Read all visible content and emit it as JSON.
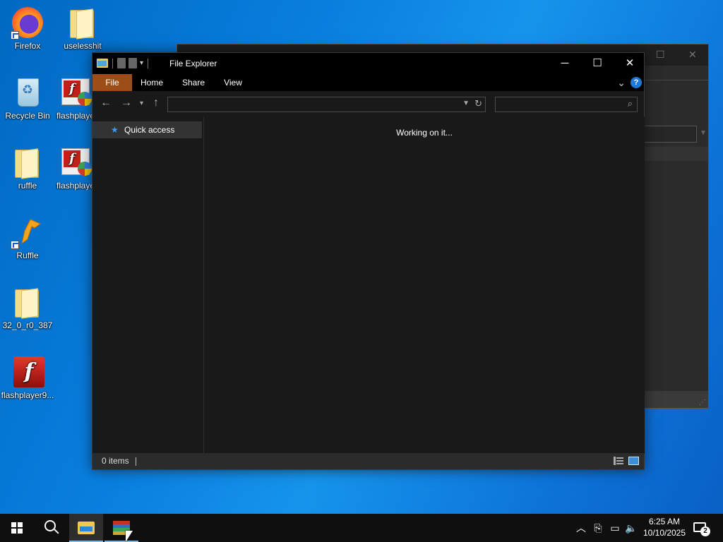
{
  "desktop": {
    "icons": [
      {
        "label": "Firefox",
        "icon": "firefox-icon"
      },
      {
        "label": "uselesshit",
        "icon": "folder-icon"
      },
      {
        "label": "Recycle Bin",
        "icon": "recycle-bin-icon"
      },
      {
        "label": "flashplayer",
        "icon": "winrar-archive-icon"
      },
      {
        "label": "ruffle",
        "icon": "folder-icon"
      },
      {
        "label": "flashplayer",
        "icon": "winrar-archive-icon"
      },
      {
        "label": "Ruffle",
        "icon": "ruffle-icon"
      },
      {
        "label": "32_0_r0_387",
        "icon": "folder-icon"
      },
      {
        "label": "flashplayer9...",
        "icon": "flash-player-icon"
      }
    ]
  },
  "explorer": {
    "title": "File Explorer",
    "ribbon_tabs": [
      "File",
      "Home",
      "Share",
      "View"
    ],
    "address_value": "",
    "search_placeholder": "",
    "nav_pane": {
      "quick_access": "Quick access"
    },
    "content_message": "Working on it...",
    "status": {
      "item_count": "0 items"
    },
    "colors": {
      "file_tab": "#9d4e18",
      "title_bar": "#000000",
      "background": "#191919"
    }
  },
  "taskbar": {
    "time": "6:25 AM",
    "date": "10/10/2025",
    "notification_count": "2"
  }
}
